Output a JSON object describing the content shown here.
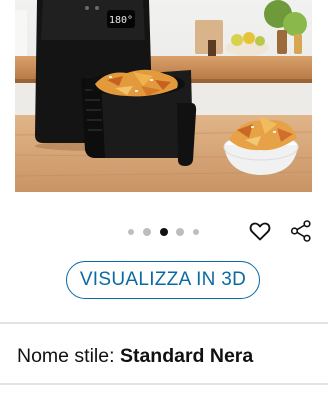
{
  "product_image": {
    "display_readout": "180°",
    "icon": "air-fryer-product-photo"
  },
  "carousel": {
    "dot_count": 5,
    "active_index": 2
  },
  "actions": {
    "wishlist_icon": "heart-icon",
    "share_icon": "share-icon"
  },
  "view_3d": {
    "label": "VISUALIZZA IN 3D",
    "color": "#0b6aa2"
  },
  "style": {
    "label": "Nome stile:",
    "value": "Standard Nera"
  }
}
